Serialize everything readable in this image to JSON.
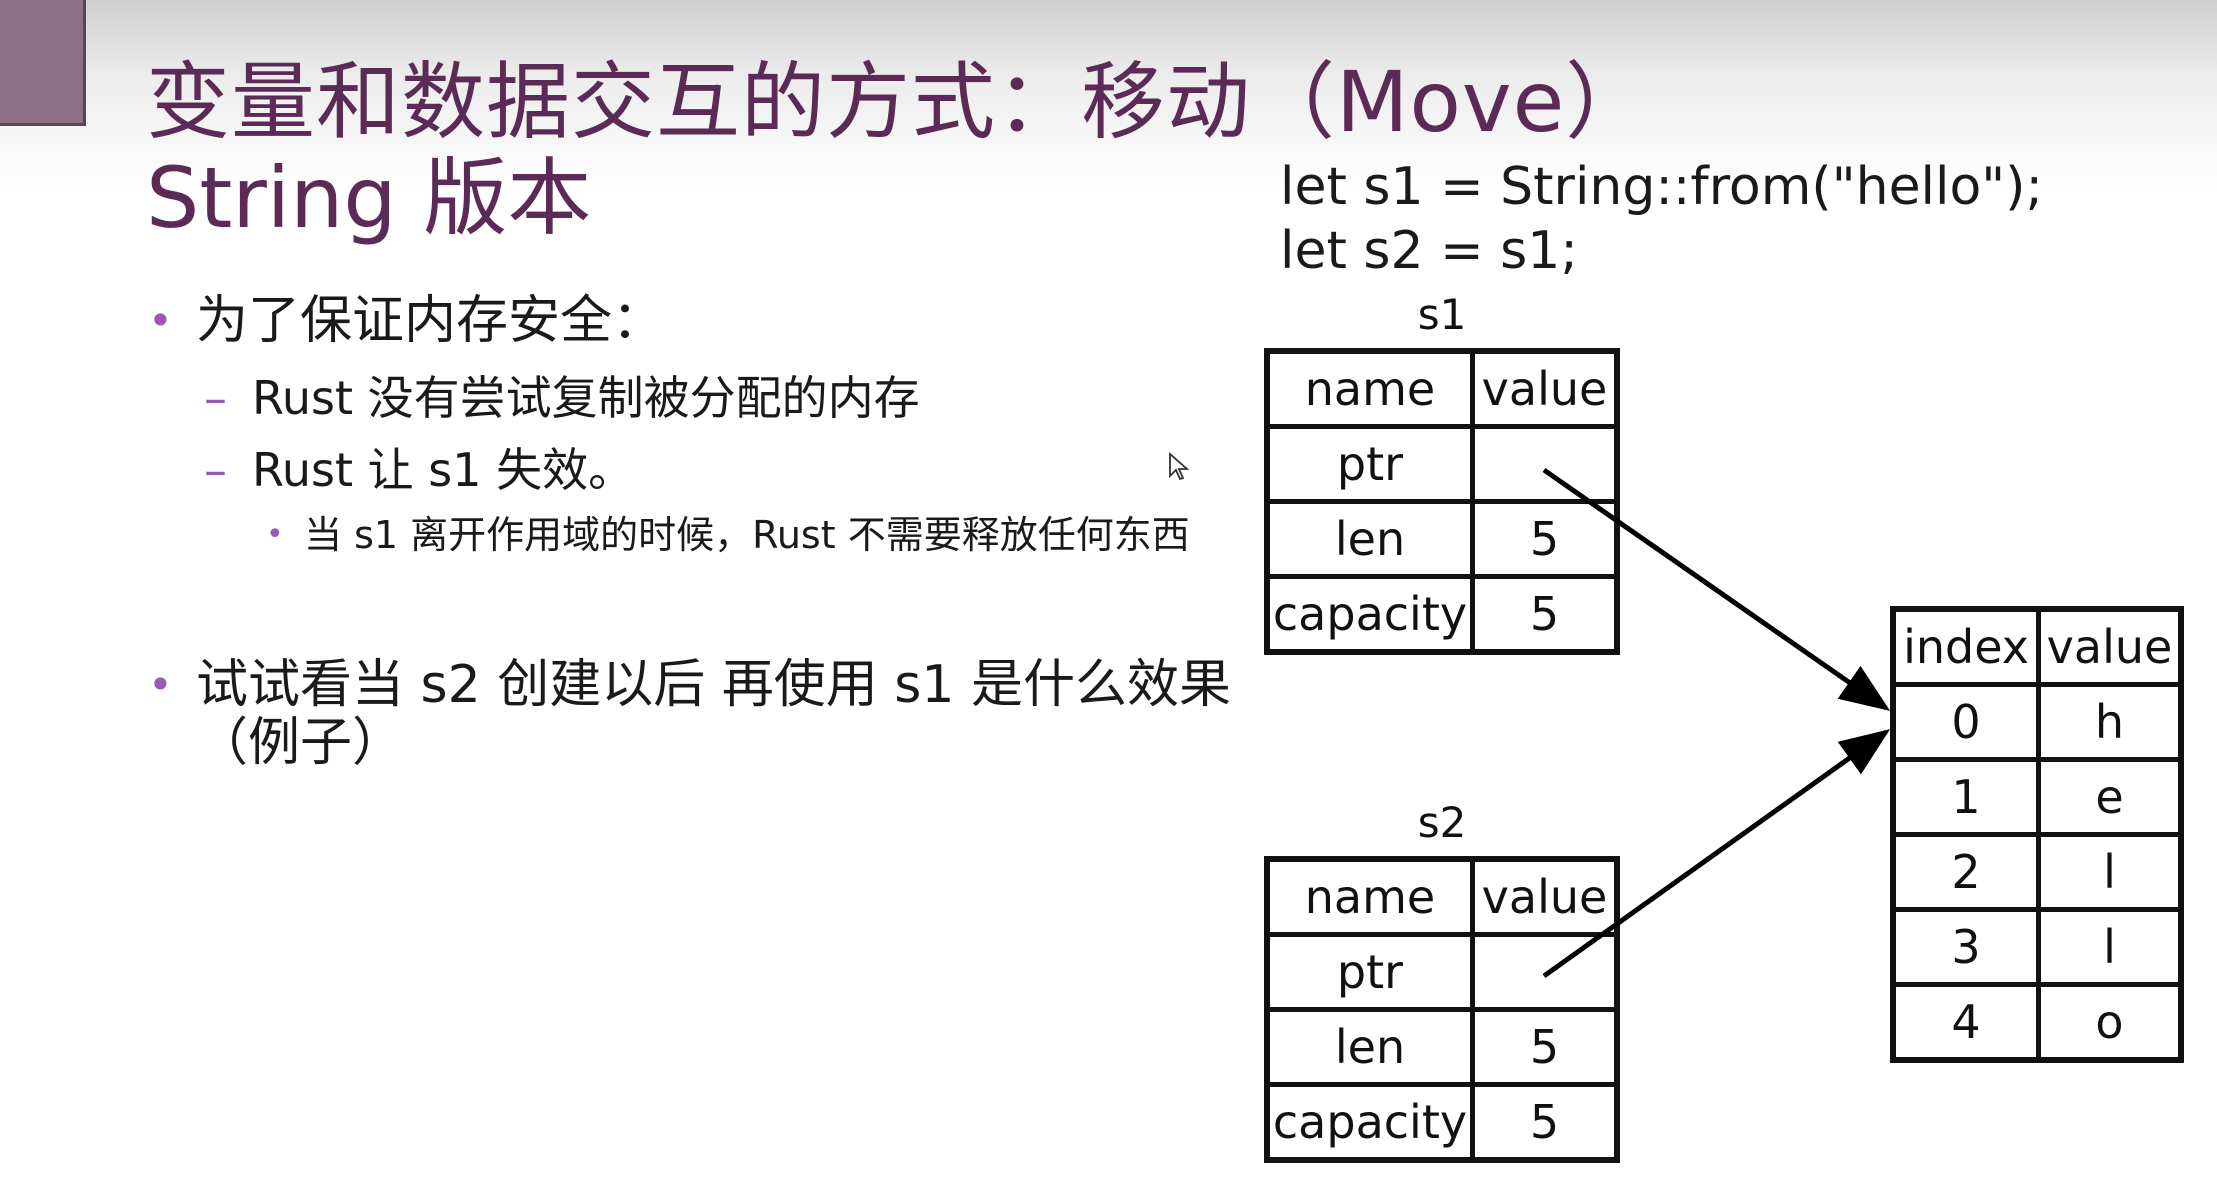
{
  "slide": {
    "title_line1": "变量和数据交互的方式：移动（Move）",
    "title_line2": "String 版本",
    "code": [
      "let s1 = String::from(\"hello\");",
      "let s2 = s1;"
    ]
  },
  "bullets": {
    "b1": "为了保证内存安全：",
    "b1_sub1": "Rust 没有尝试复制被分配的内存",
    "b1_sub2": "Rust 让 s1 失效。",
    "b1_sub2_sub": "当 s1 离开作用域的时候，Rust 不需要释放任何东西",
    "b2": "试试看当 s2 创建以后 再使用 s1 是什么效果（例子）"
  },
  "diagram": {
    "s1_label": "s1",
    "s2_label": "s2",
    "stack_header": [
      "name",
      "value"
    ],
    "s1_rows": [
      [
        "ptr",
        ""
      ],
      [
        "len",
        "5"
      ],
      [
        "capacity",
        "5"
      ]
    ],
    "s2_rows": [
      [
        "ptr",
        ""
      ],
      [
        "len",
        "5"
      ],
      [
        "capacity",
        "5"
      ]
    ],
    "heap_header": [
      "index",
      "value"
    ],
    "heap_rows": [
      [
        "0",
        "h"
      ],
      [
        "1",
        "e"
      ],
      [
        "2",
        "l"
      ],
      [
        "3",
        "l"
      ],
      [
        "4",
        "o"
      ]
    ]
  },
  "colors": {
    "title": "#5b2a57",
    "bullet_accent": "#9b59b6",
    "corner_block": "#8e6f88"
  }
}
